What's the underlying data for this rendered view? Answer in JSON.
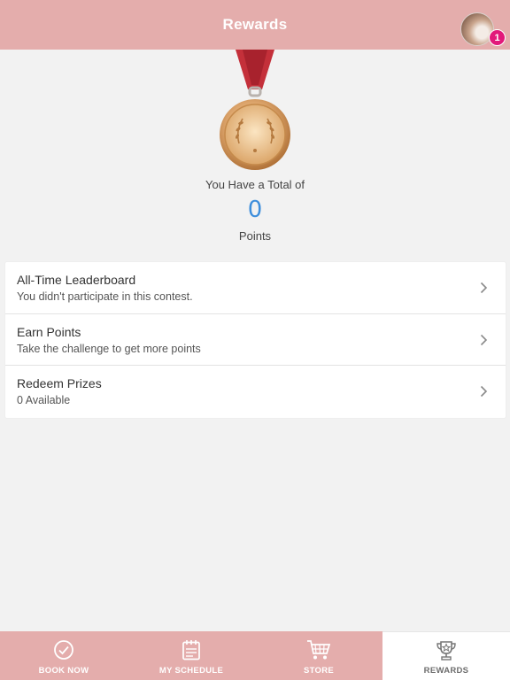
{
  "header": {
    "title": "Rewards",
    "notification_count": "1"
  },
  "points": {
    "caption": "You Have a Total of",
    "value": "0",
    "unit": "Points"
  },
  "menu": {
    "items": [
      {
        "title": "All-Time Leaderboard",
        "subtitle": "You didn't participate in this contest."
      },
      {
        "title": "Earn Points",
        "subtitle": "Take the challenge to get more points"
      },
      {
        "title": "Redeem Prizes",
        "subtitle": "0 Available"
      }
    ]
  },
  "tabbar": {
    "tabs": [
      {
        "label": "BOOK NOW",
        "icon": "check-circle-icon"
      },
      {
        "label": "MY SCHEDULE",
        "icon": "calendar-icon"
      },
      {
        "label": "STORE",
        "icon": "cart-icon"
      },
      {
        "label": "REWARDS",
        "icon": "trophy-icon",
        "active": true
      }
    ]
  },
  "colors": {
    "header_bg": "#e4adac",
    "accent_blue": "#3f8fdc",
    "badge": "#e2197a",
    "ribbon": "#c4303a",
    "medal_gold": "#d9a15e"
  }
}
